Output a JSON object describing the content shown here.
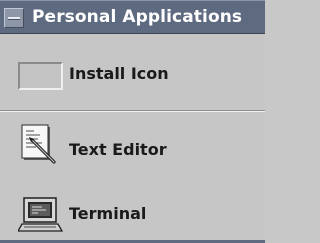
{
  "panel": {
    "title": "Personal Applications",
    "collapse_icon": "minus-icon"
  },
  "items": [
    {
      "label": "Install Icon",
      "icon": "install-drop-target"
    },
    {
      "label": "Text Editor",
      "icon": "text-editor-icon"
    },
    {
      "label": "Terminal",
      "icon": "terminal-icon"
    }
  ],
  "colors": {
    "titlebar": "#5e6a80",
    "background": "#c6c6c6",
    "title_text": "#ffffff",
    "item_text": "#1a1a1a"
  }
}
